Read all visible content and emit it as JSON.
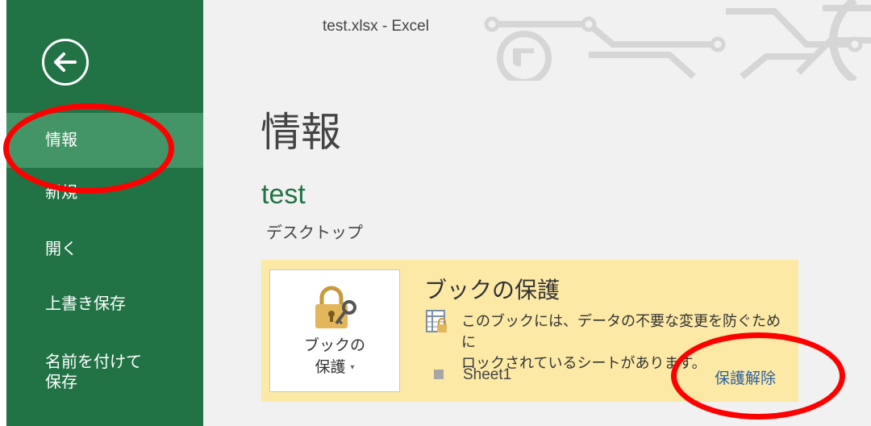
{
  "window": {
    "title": "test.xlsx - Excel"
  },
  "sidebar": {
    "back_icon": "back-arrow-icon",
    "items": [
      {
        "label": "情報",
        "active": true
      },
      {
        "label": "新規"
      },
      {
        "label": "開く"
      },
      {
        "label": "上書き保存"
      },
      {
        "label_line1": "名前を付けて",
        "label_line2": "保存"
      }
    ]
  },
  "main": {
    "page_title": "情報",
    "file": {
      "name": "test",
      "location": "デスクトップ"
    },
    "protect_workbook": {
      "button_label_line1": "ブックの",
      "button_label_line2": "保護",
      "heading": "ブックの保護",
      "description_line1": "このブックには、データの不要な変更を防ぐために",
      "description_line2": "ロックされているシートがあります。",
      "sheet_name": "Sheet1",
      "unprotect_link": "保護解除"
    }
  },
  "colors": {
    "sidebar": "#217346",
    "sidebar_active": "#439467",
    "panel": "#fce9a6",
    "annotation": "#ff0000",
    "link": "#2e5f9e"
  }
}
